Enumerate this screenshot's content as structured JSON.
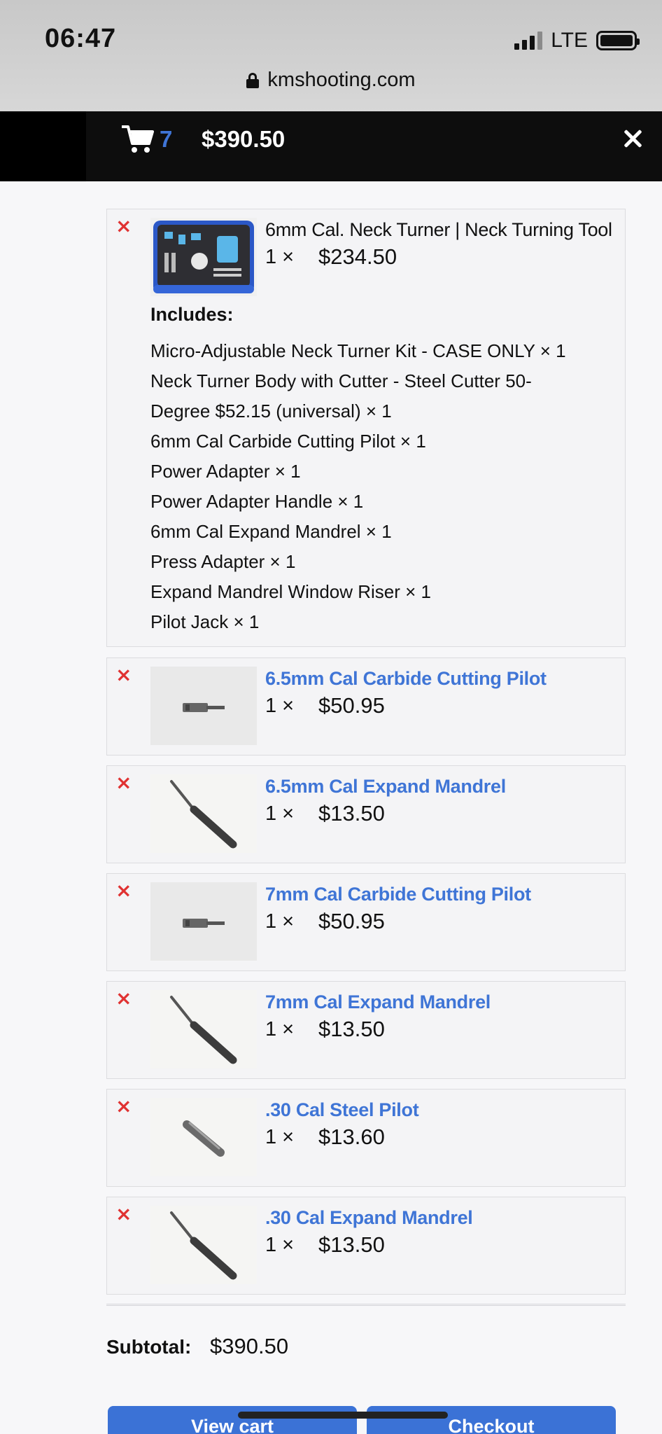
{
  "status_bar": {
    "time": "06:47",
    "network": "LTE"
  },
  "browser": {
    "url": "kmshooting.com"
  },
  "cart_header": {
    "count": "7",
    "total": "$390.50",
    "cart_icon": "shopping-cart-icon",
    "close_icon": "close-icon"
  },
  "items": [
    {
      "name": "6mm Cal. Neck Turner | Neck Turning Tool",
      "qty": "1 ×",
      "price": "$234.50",
      "includes_title": "Includes:",
      "includes": [
        "Micro-Adjustable Neck Turner Kit - CASE ONLY × 1",
        "Neck Turner Body with Cutter - Steel Cutter 50-",
        "Degree $52.15 (universal) × 1",
        "6mm Cal Carbide Cutting Pilot × 1",
        "Power Adapter × 1",
        "Power Adapter Handle × 1",
        "6mm Cal Expand Mandrel × 1",
        "Press Adapter × 1",
        "Expand Mandrel Window Riser × 1",
        "Pilot Jack × 1"
      ]
    },
    {
      "name": "6.5mm Cal Carbide Cutting Pilot",
      "qty": "1 ×",
      "price": "$50.95"
    },
    {
      "name": "6.5mm Cal Expand Mandrel",
      "qty": "1 ×",
      "price": "$13.50"
    },
    {
      "name": "7mm Cal Carbide Cutting Pilot",
      "qty": "1 ×",
      "price": "$50.95"
    },
    {
      "name": "7mm Cal Expand Mandrel",
      "qty": "1 ×",
      "price": "$13.50"
    },
    {
      "name": ".30 Cal Steel Pilot",
      "qty": "1 ×",
      "price": "$13.60"
    },
    {
      "name": ".30 Cal Expand Mandrel",
      "qty": "1 ×",
      "price": "$13.50"
    }
  ],
  "remove_symbol": "×",
  "subtotal": {
    "label": "Subtotal:",
    "value": "$390.50"
  },
  "buttons": {
    "view_cart": "View cart",
    "checkout": "Checkout"
  },
  "colors": {
    "accent": "#3f75d6",
    "remove": "#e03232",
    "header_bg": "#000000"
  }
}
